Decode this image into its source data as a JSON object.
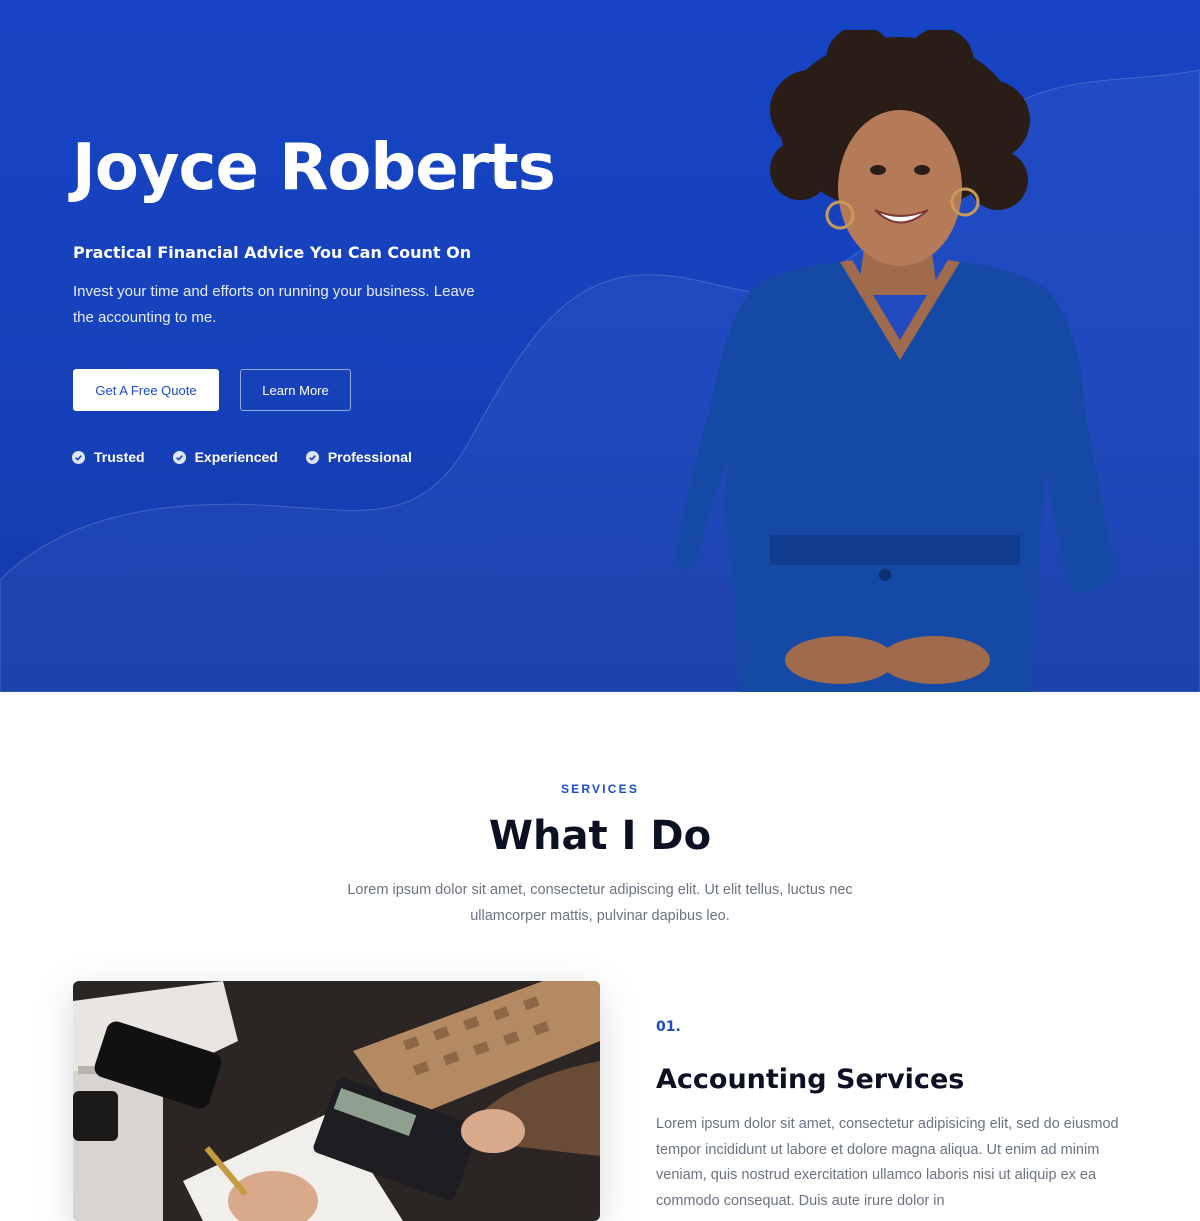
{
  "hero": {
    "name": "Joyce Roberts",
    "tagline": "Practical Financial Advice You Can Count On",
    "description": "Invest your time and efforts on running your business. Leave the accounting to me.",
    "buttons": {
      "primary": "Get A Free Quote",
      "secondary": "Learn More"
    },
    "badges": [
      "Trusted",
      "Experienced",
      "Professional"
    ]
  },
  "services": {
    "eyebrow": "SERVICES",
    "title": "What I Do",
    "description": "Lorem ipsum dolor sit amet, consectetur adipiscing elit. Ut elit tellus, luctus nec ullamcorper mattis, pulvinar dapibus leo.",
    "items": [
      {
        "number": "01.",
        "title": "Accounting Services",
        "description": "Lorem ipsum dolor sit amet, consectetur adipisicing elit, sed do eiusmod tempor incididunt ut labore et dolore magna aliqua. Ut enim ad minim veniam, quis nostrud exercitation ullamco laboris nisi ut aliquip ex ea commodo consequat. Duis aute irure dolor in"
      }
    ]
  },
  "colors": {
    "hero_bg": "#1644c4",
    "accent": "#1a4bc8",
    "heading": "#0b1023",
    "body_text": "#6b7280"
  },
  "icons": {
    "badge": "check-circle-icon"
  }
}
